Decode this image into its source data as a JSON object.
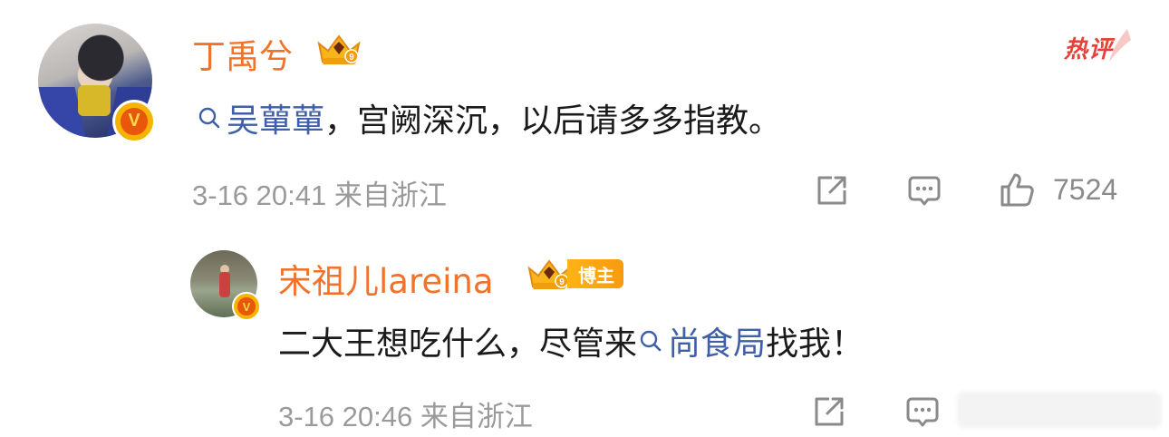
{
  "main_comment": {
    "username": "丁禹兮",
    "mention_name": "吴蕇蕇",
    "text_after_mention": "，宫阙深沉，以后请多多指教。",
    "timestamp": "3-16 20:41",
    "location": "来自浙江",
    "likes": "7524",
    "hot_label": "热评"
  },
  "reply": {
    "username": "宋祖儿lareina",
    "tag": "博主",
    "text_before_mention": "二大王想吃什么，尽管来",
    "mention_name": "尚食局",
    "text_after_mention": "找我！",
    "timestamp": "3-16 20:46",
    "location": "来自浙江"
  },
  "icons": {
    "verified": "v-badge-icon",
    "level": "crown-icon",
    "share": "share-icon",
    "comment": "comment-icon",
    "like": "thumbs-up-icon",
    "search": "search-icon"
  },
  "colors": {
    "username": "#f1732a",
    "mention": "#3f5fa8",
    "meta": "#9a9a9a",
    "hot": "#e8413b"
  }
}
